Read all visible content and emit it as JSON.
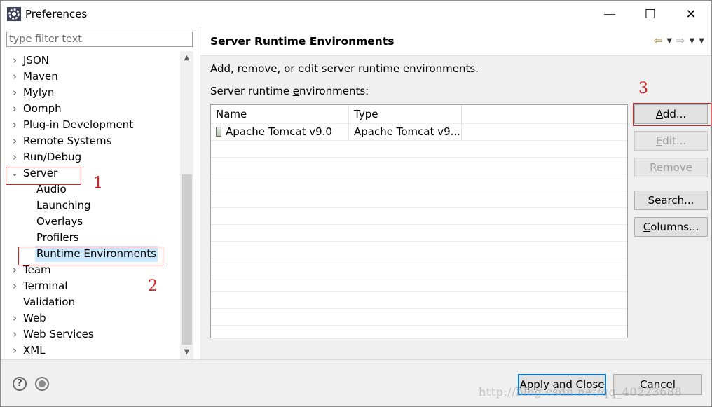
{
  "window": {
    "title": "Preferences",
    "minimize_glyph": "—",
    "maximize_glyph": "☐",
    "close_glyph": "✕"
  },
  "filter": {
    "placeholder": "type filter text",
    "value": ""
  },
  "tree": {
    "items": [
      {
        "label": "JSON",
        "arrow": "›"
      },
      {
        "label": "Maven",
        "arrow": "›"
      },
      {
        "label": "Mylyn",
        "arrow": "›"
      },
      {
        "label": "Oomph",
        "arrow": "›"
      },
      {
        "label": "Plug-in Development",
        "arrow": "›"
      },
      {
        "label": "Remote Systems",
        "arrow": "›"
      },
      {
        "label": "Run/Debug",
        "arrow": "›"
      },
      {
        "label": "Server",
        "arrow": "⌄"
      },
      {
        "label": "Audio",
        "arrow": ""
      },
      {
        "label": "Launching",
        "arrow": ""
      },
      {
        "label": "Overlays",
        "arrow": ""
      },
      {
        "label": "Profilers",
        "arrow": ""
      },
      {
        "label": "Runtime Environments",
        "arrow": ""
      },
      {
        "label": "Team",
        "arrow": "›"
      },
      {
        "label": "Terminal",
        "arrow": "›"
      },
      {
        "label": "Validation",
        "arrow": ""
      },
      {
        "label": "Web",
        "arrow": "›"
      },
      {
        "label": "Web Services",
        "arrow": "›"
      },
      {
        "label": "XML",
        "arrow": "›"
      }
    ],
    "selected": "Runtime Environments"
  },
  "annotations": {
    "num1": "1",
    "num2": "2",
    "num3": "3",
    "color": "#e02020"
  },
  "page": {
    "title": "Server Runtime Environments",
    "description": "Add, remove, or edit server runtime environments.",
    "list_label_pre": "Server runtime ",
    "list_label_mnemonic": "e",
    "list_label_post": "nvironments:"
  },
  "table": {
    "columns": [
      "Name",
      "Type"
    ],
    "rows": [
      {
        "name": "Apache Tomcat v9.0",
        "type": "Apache Tomcat v9..."
      }
    ]
  },
  "buttons": {
    "add": {
      "mnemonic": "A",
      "rest": "dd..."
    },
    "edit": {
      "mnemonic": "E",
      "rest": "dit..."
    },
    "remove": {
      "mnemonic": "R",
      "rest": "emove"
    },
    "search": {
      "mnemonic": "S",
      "rest": "earch..."
    },
    "columns": {
      "mnemonic": "C",
      "rest": "olumns..."
    },
    "apply_close": "Apply and Close",
    "cancel": "Cancel"
  },
  "icons": {
    "help": "?",
    "back": "⇦",
    "forward": "⇨",
    "dropdown": "▼",
    "scroll_up": "▲",
    "scroll_down": "▼"
  },
  "watermark": "http://blog.csdn.net/qq_40223688",
  "colors": {
    "selection": "#cce8ff",
    "accent": "#0078d7",
    "annotation": "#e02020"
  }
}
